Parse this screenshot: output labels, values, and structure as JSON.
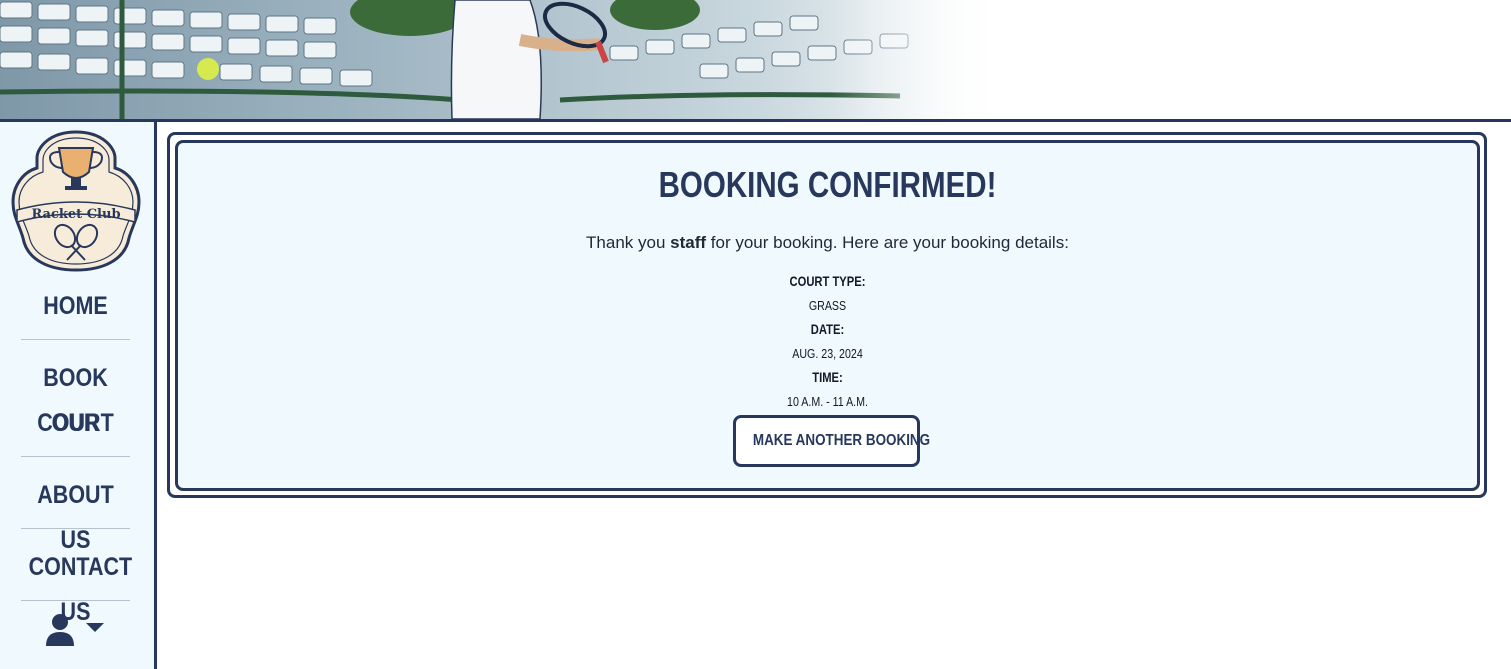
{
  "nav": {
    "home": "Home",
    "book_line1": "Book Our",
    "book_line2": "Court",
    "about": "About Us",
    "contact": "Contact Us"
  },
  "logo": {
    "text": "Racket Club"
  },
  "confirmation": {
    "title": "Booking Confirmed!",
    "thanks_prefix": "Thank you ",
    "username": "staff",
    "thanks_suffix": " for your booking. Here are your booking details:",
    "court_type_label": "Court Type:",
    "court_type_value": "Grass",
    "date_label": "Date:",
    "date_value": "Aug. 23, 2024",
    "time_label": "Time:",
    "time_value": "10 a.m. - 11 a.m.",
    "button_label": "Make another booking"
  },
  "colors": {
    "navy": "#27385c",
    "panel_bg": "#f0f9fd",
    "accent_gold": "#e9b070"
  },
  "icons": [
    "user-icon",
    "caret-down-icon",
    "trophy-icon",
    "crossed-rackets-icon"
  ]
}
